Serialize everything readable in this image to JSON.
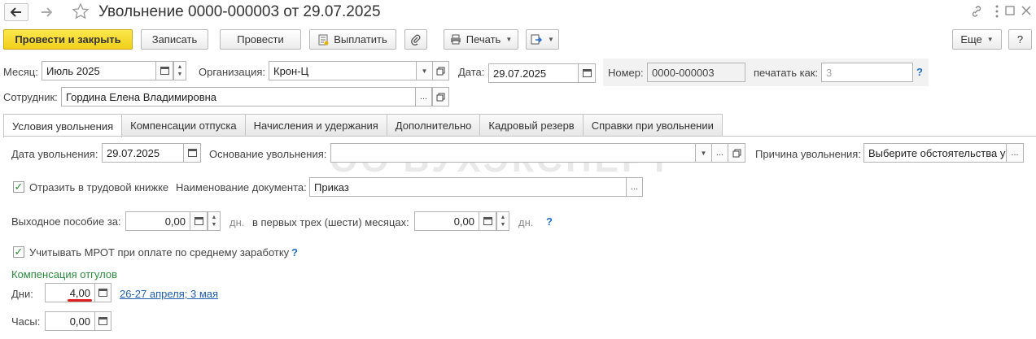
{
  "window": {
    "title": "Увольнение 0000-000003 от 29.07.2025",
    "icons": [
      "back-arrow-icon",
      "forward-arrow-icon",
      "star-icon",
      "link-icon",
      "more-vertical-icon",
      "maximize-icon",
      "close-icon"
    ]
  },
  "toolbar": {
    "post_and_close": "Провести и закрыть",
    "save": "Записать",
    "post": "Провести",
    "pay": "Выплатить",
    "print": "Печать",
    "more": "Еще",
    "help": "?"
  },
  "header": {
    "month_label": "Месяц:",
    "month_value": "Июль 2025",
    "org_label": "Организация:",
    "org_value": "Крон-Ц",
    "date_label": "Дата:",
    "date_value": "29.07.2025",
    "number_label": "Номер:",
    "number_value": "0000-000003",
    "print_as_label": "печатать как:",
    "print_as_value": "3",
    "help": "?",
    "employee_label": "Сотрудник:",
    "employee_value": "Гордина Елена Владимировна"
  },
  "tabs": [
    {
      "label": "Условия увольнения",
      "active": true
    },
    {
      "label": "Компенсации отпуска",
      "active": false
    },
    {
      "label": "Начисления и удержания",
      "active": false
    },
    {
      "label": "Дополнительно",
      "active": false
    },
    {
      "label": "Кадровый резерв",
      "active": false
    },
    {
      "label": "Справки при увольнении",
      "active": false
    }
  ],
  "conditions": {
    "dismissal_date_label": "Дата увольнения:",
    "dismissal_date_value": "29.07.2025",
    "basis_label": "Основание увольнения:",
    "basis_value": "",
    "reason_label": "Причина увольнения:",
    "reason_value": "Выберите обстоятельства увольнения",
    "workbook_checked": true,
    "workbook_label": "Отразить в трудовой книжке",
    "doc_name_label": "Наименование документа:",
    "doc_name_value": "Приказ",
    "severance_label": "Выходное пособие за:",
    "severance_days": "0,00",
    "days_unit": "дн.",
    "first_months_label": "в первых трех (шести) месяцах:",
    "first_months_days": "0,00",
    "help": "?",
    "mrot_checked": true,
    "mrot_label": "Учитывать МРОТ при оплате по среднему заработку",
    "comp_section": "Компенсация отгулов",
    "days_label": "Дни:",
    "days_value": "4,00",
    "days_link": "26-27 апреля;  3 мая",
    "hours_label": "Часы:",
    "hours_value": "0,00"
  },
  "watermark": {
    "logo_letters": "ОО",
    "text": "БУХЭКСПЕРТ"
  },
  "colors": {
    "primary_button": "#f5d52a",
    "link": "#1e5fb0",
    "section_title": "#2b8a3e",
    "underline_mark": "#e02020"
  }
}
